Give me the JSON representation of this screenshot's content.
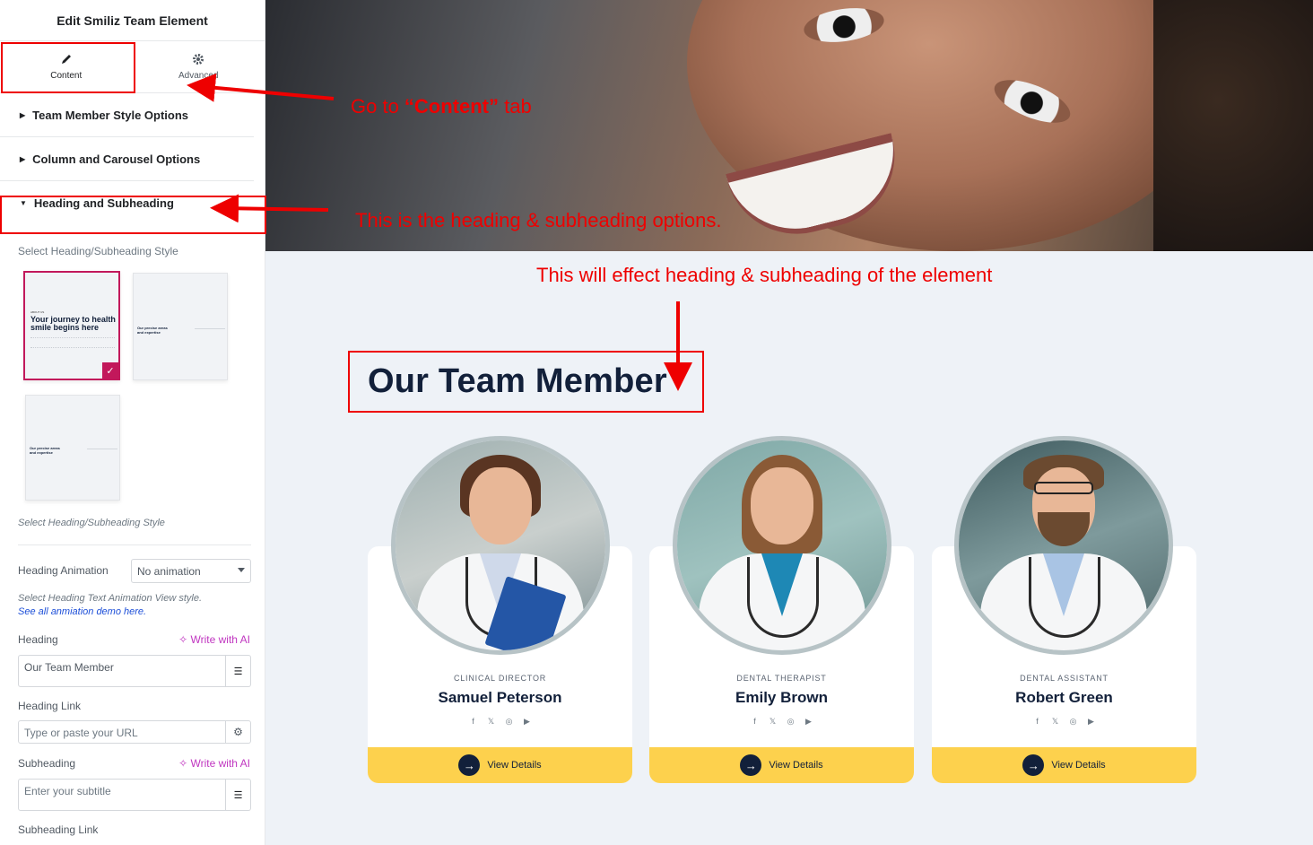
{
  "panel": {
    "title": "Edit Smiliz Team Element",
    "tabs": [
      {
        "label": "Content",
        "icon": "pencil-icon",
        "active": true
      },
      {
        "label": "Advanced",
        "icon": "gear-icon",
        "active": false
      }
    ],
    "sections": [
      {
        "label": "Team Member Style Options",
        "expanded": false
      },
      {
        "label": "Column and Carousel Options",
        "expanded": false
      },
      {
        "label": "Heading and Subheading",
        "expanded": true
      }
    ],
    "style_select_label": "Select Heading/Subheading Style",
    "style_thumb_1": {
      "tag": "ABOUT US",
      "title": "Your journey to health smile begins here"
    },
    "style_thumb_2": {
      "title": "Our precise areas and expertise"
    },
    "style_thumb_3": {
      "title": "Our precise areas and expertise"
    },
    "style_help": "Select Heading/Subheading Style",
    "heading_animation": {
      "label": "Heading Animation",
      "value": "No animation"
    },
    "animation_help": "Select Heading Text Animation View style.",
    "animation_link": "See all anmiation demo here.",
    "heading": {
      "label": "Heading",
      "ai": "Write with AI",
      "value": "Our Team Member"
    },
    "heading_link": {
      "label": "Heading Link",
      "placeholder": "Type or paste your URL"
    },
    "subheading": {
      "label": "Subheading",
      "ai": "Write with AI",
      "placeholder": "Enter your subtitle"
    },
    "subheading_link": {
      "label": "Subheading Link"
    },
    "collapse_icon": "chevron-left-icon"
  },
  "preview": {
    "heading": "Our Team Member",
    "members": [
      {
        "role": "CLINICAL DIRECTOR",
        "name": "Samuel Peterson",
        "button": "View Details"
      },
      {
        "role": "DENTAL THERAPIST",
        "name": "Emily Brown",
        "button": "View Details"
      },
      {
        "role": "DENTAL ASSISTANT",
        "name": "Robert Green",
        "button": "View Details"
      }
    ],
    "social_icons": [
      "facebook-icon",
      "x-icon",
      "instagram-icon",
      "youtube-icon"
    ],
    "social_glyphs": [
      "f",
      "𝕏",
      "◎",
      "▶"
    ]
  },
  "annotations": {
    "content_tab_prefix": "Go  to ",
    "content_tab_bold": "“Content”",
    "content_tab_suffix": " tab",
    "heading_options": "This is the heading & subheading options.",
    "effect": "This will effect heading & subheading of the element"
  },
  "colors": {
    "annotation_red": "#ee0000",
    "accent_pink": "#c2185b",
    "button_yellow": "#fdd14d",
    "heading_navy": "#12203a",
    "ai_purple": "#c036c0"
  }
}
